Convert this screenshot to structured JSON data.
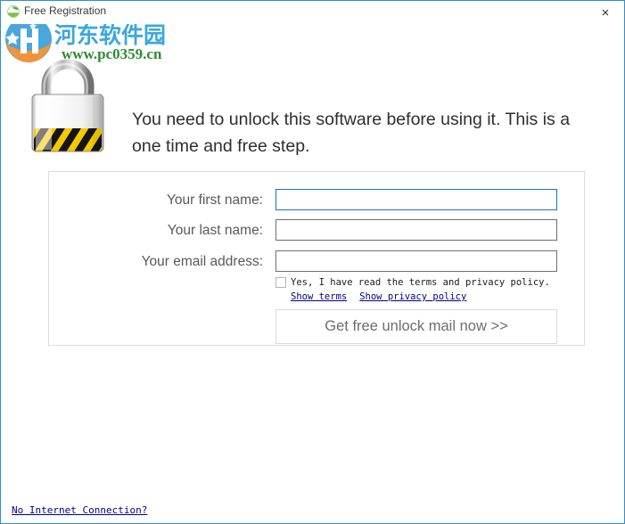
{
  "window": {
    "title": "Free Registration",
    "title_icon": "globe-icon",
    "close_label": "×",
    "border_color": "#2f8fce"
  },
  "watermark": {
    "site_name_cn": "河东软件园",
    "site_url": "www.pc0359.cn",
    "cn_color": "#3ba7df",
    "url_color": "#2a8b33",
    "logo_icon": "site-logo-icon"
  },
  "illustration": {
    "icon": "padlock-icon",
    "stripe_colors": [
      "#f2c200",
      "#1a1a1a"
    ]
  },
  "headline": {
    "text": "You need to unlock this software before using it. This is a one time and free step."
  },
  "form": {
    "fields": [
      {
        "label": "Your first name:",
        "value": "",
        "placeholder": "",
        "focused": true,
        "name": "first-name"
      },
      {
        "label": "Your last name:",
        "value": "",
        "placeholder": "",
        "focused": false,
        "name": "last-name"
      },
      {
        "label": "Your email address:",
        "value": "",
        "placeholder": "",
        "focused": false,
        "name": "email-address"
      }
    ],
    "consent": {
      "checked": false,
      "label": "Yes, I have read the terms and privacy policy."
    },
    "links": [
      {
        "label": "Show terms"
      },
      {
        "label": "Show privacy policy"
      }
    ],
    "submit_label": "Get free unlock mail now >>",
    "accent_color": "#0f7ab0",
    "link_color": "#00008b"
  },
  "footer": {
    "no_internet_label": "No Internet Connection?"
  }
}
